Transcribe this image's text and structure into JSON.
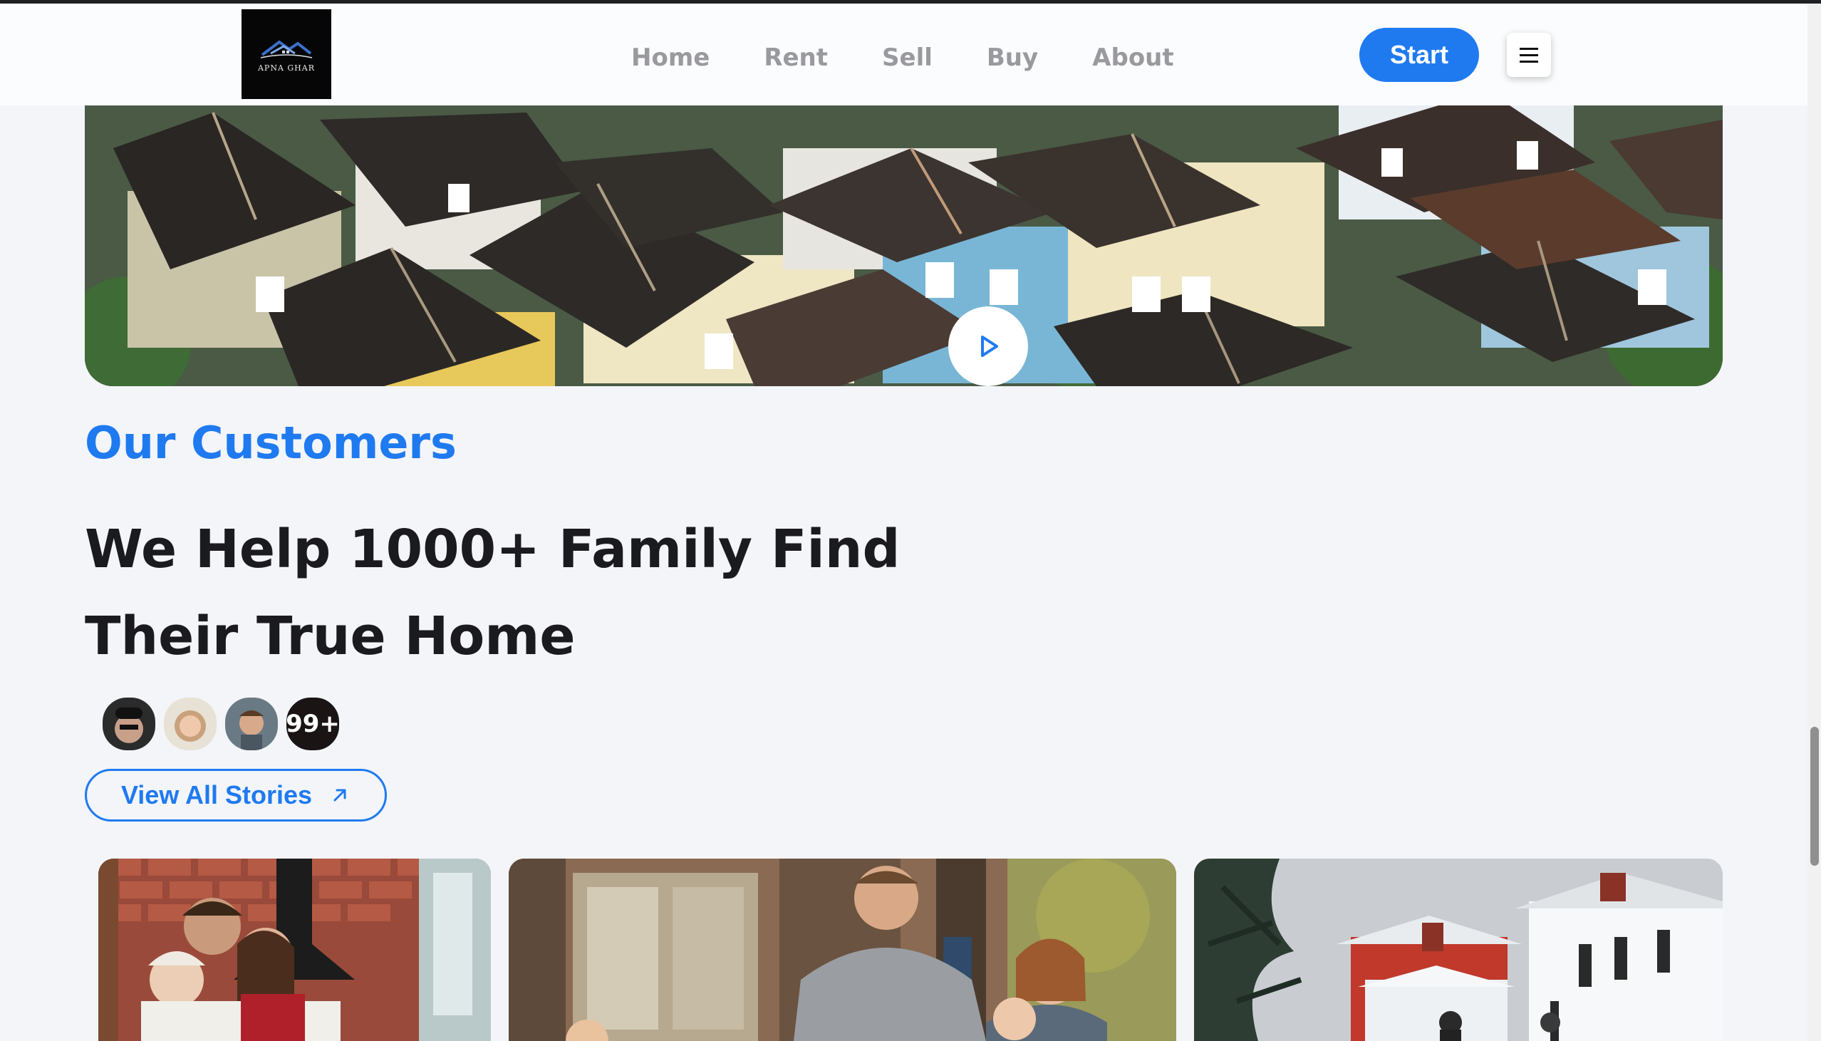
{
  "header": {
    "logo_text": "APNA GHAR",
    "nav": [
      "Home",
      "Rent",
      "Sell",
      "Buy",
      "About"
    ],
    "start_label": "Start"
  },
  "hero": {
    "play_icon": "play-icon"
  },
  "customers": {
    "eyebrow": "Our Customers",
    "headline_line1": "We Help 1000+ Family Find",
    "headline_line2": "Their True Home",
    "avatar_count": "99+",
    "stories_button": "View All Stories"
  },
  "colors": {
    "accent": "#1f7af0",
    "text": "#1b1b1f",
    "nav": "#9a9a9e",
    "background": "#f3f5f9"
  }
}
